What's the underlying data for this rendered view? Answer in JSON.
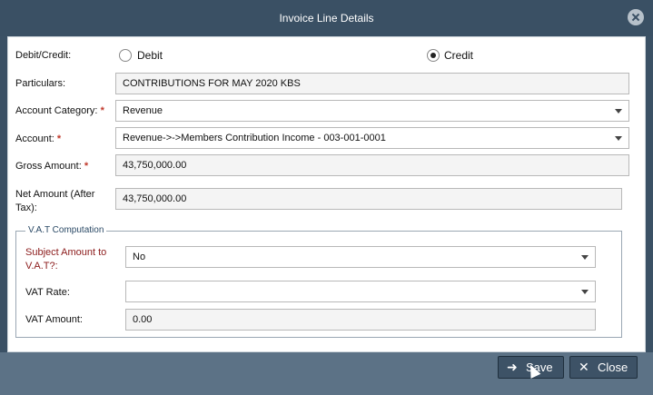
{
  "dialog": {
    "title": "Invoice Line Details"
  },
  "form": {
    "debit_credit": {
      "label": "Debit/Credit:",
      "options": [
        "Debit",
        "Credit"
      ],
      "selected": "Credit"
    },
    "particulars": {
      "label": "Particulars:",
      "value": "CONTRIBUTIONS FOR MAY 2020 KBS"
    },
    "account_category": {
      "label": "Account Category:",
      "required_mark": "*",
      "value": "Revenue"
    },
    "account": {
      "label": "Account:",
      "required_mark": "*",
      "value": "Revenue->->Members Contribution Income - 003-001-0001"
    },
    "gross_amount": {
      "label": "Gross Amount:",
      "required_mark": "*",
      "value": "43,750,000.00"
    },
    "net_amount": {
      "label_line1": "Net Amount (After",
      "label_line2": "Tax):",
      "value": "43,750,000.00"
    }
  },
  "vat": {
    "legend": "V.A.T Computation",
    "subject_amount": {
      "label_line1": "Subject Amount to",
      "label_line2": "V.A.T?:",
      "value": "No",
      "label_color": "#8b1a1a"
    },
    "vat_rate": {
      "label": "VAT Rate:",
      "value": ""
    },
    "vat_amount": {
      "label": "VAT Amount:",
      "value": "0.00"
    }
  },
  "footer": {
    "save_label": "Save",
    "close_label": "Close",
    "save_icon": "sign-in-icon",
    "close_icon": "x-icon"
  }
}
